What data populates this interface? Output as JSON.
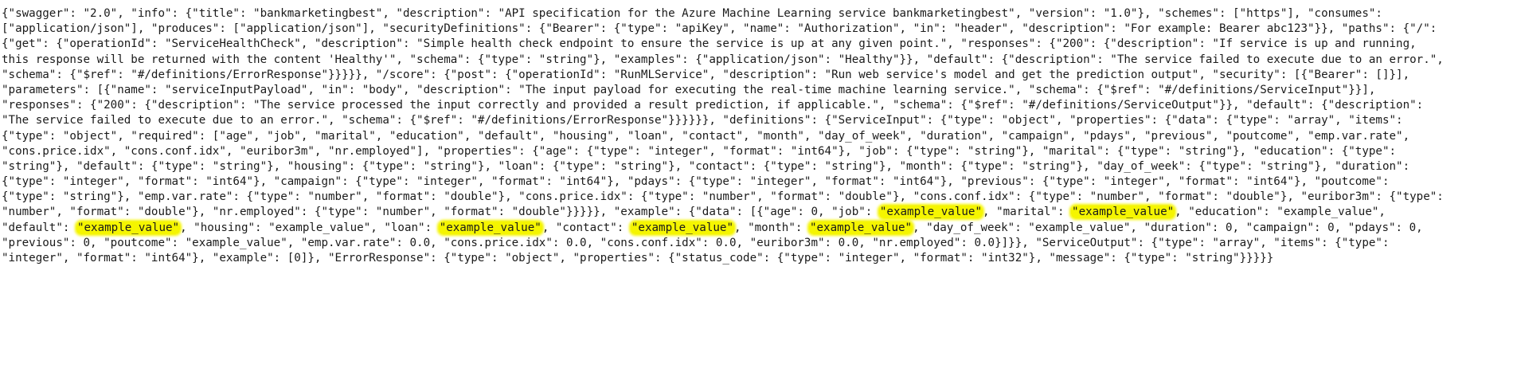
{
  "highlight_color": "#f5f500",
  "document": {
    "lines": [
      [
        {
          "text": "{\"swagger\": \"2.0\", \"info\": {\"title\": \"bankmarketingbest\", \"description\": \"API specification for the Azure Machine Learning service bankmarketingbest\", \"version\": \"1.0\"}, \"schemes\": [\"https\"], \"consumes\":",
          "highlight": false
        }
      ],
      [
        {
          "text": "[\"application/json\"], \"produces\": [\"application/json\"], \"securityDefinitions\": {\"Bearer\": {\"type\": \"apiKey\", \"name\": \"Authorization\", \"in\": \"header\", \"description\": \"For example: Bearer abc123\"}}, \"paths\": {\"/\":",
          "highlight": false
        }
      ],
      [
        {
          "text": "{\"get\": {\"operationId\": \"ServiceHealthCheck\", \"description\": \"Simple health check endpoint to ensure the service is up at any given point.\", \"responses\": {\"200\": {\"description\": \"If service is up and running,",
          "highlight": false
        }
      ],
      [
        {
          "text": "this response will be returned with the content 'Healthy'\", \"schema\": {\"type\": \"string\"}, \"examples\": {\"application/json\": \"Healthy\"}}, \"default\": {\"description\": \"The service failed to execute due to an error.\",",
          "highlight": false
        }
      ],
      [
        {
          "text": "\"schema\": {\"$ref\": \"#/definitions/ErrorResponse\"}}}}}, \"/score\": {\"post\": {\"operationId\": \"RunMLService\", \"description\": \"Run web service's model and get the prediction output\", \"security\": [{\"Bearer\": []}],",
          "highlight": false
        }
      ],
      [
        {
          "text": "\"parameters\": [{\"name\": \"serviceInputPayload\", \"in\": \"body\", \"description\": \"The input payload for executing the real-time machine learning service.\", \"schema\": {\"$ref\": \"#/definitions/ServiceInput\"}}],",
          "highlight": false
        }
      ],
      [
        {
          "text": "\"responses\": {\"200\": {\"description\": \"The service processed the input correctly and provided a result prediction, if applicable.\", \"schema\": {\"$ref\": \"#/definitions/ServiceOutput\"}}, \"default\": {\"description\":",
          "highlight": false
        }
      ],
      [
        {
          "text": "\"The service failed to execute due to an error.\", \"schema\": {\"$ref\": \"#/definitions/ErrorResponse\"}}}}}}, \"definitions\": {\"ServiceInput\": {\"type\": \"object\", \"properties\": {\"data\": {\"type\": \"array\", \"items\":",
          "highlight": false
        }
      ],
      [
        {
          "text": "{\"type\": \"object\", \"required\": [\"age\", \"job\", \"marital\", \"education\", \"default\", \"housing\", \"loan\", \"contact\", \"month\", \"day_of_week\", \"duration\", \"campaign\", \"pdays\", \"previous\", \"poutcome\", \"emp.var.rate\",",
          "highlight": false
        }
      ],
      [
        {
          "text": "\"cons.price.idx\", \"cons.conf.idx\", \"euribor3m\", \"nr.employed\"], \"properties\": {\"age\": {\"type\": \"integer\", \"format\": \"int64\"}, \"job\": {\"type\": \"string\"}, \"marital\": {\"type\": \"string\"}, \"education\": {\"type\":",
          "highlight": false
        }
      ],
      [
        {
          "text": "\"string\"}, \"default\": {\"type\": \"string\"}, \"housing\": {\"type\": \"string\"}, \"loan\": {\"type\": \"string\"}, \"contact\": {\"type\": \"string\"}, \"month\": {\"type\": \"string\"}, \"day_of_week\": {\"type\": \"string\"}, \"duration\":",
          "highlight": false
        }
      ],
      [
        {
          "text": "{\"type\": \"integer\", \"format\": \"int64\"}, \"campaign\": {\"type\": \"integer\", \"format\": \"int64\"}, \"pdays\": {\"type\": \"integer\", \"format\": \"int64\"}, \"previous\": {\"type\": \"integer\", \"format\": \"int64\"}, \"poutcome\":",
          "highlight": false
        }
      ],
      [
        {
          "text": "{\"type\": \"string\"}, \"emp.var.rate\": {\"type\": \"number\", \"format\": \"double\"}, \"cons.price.idx\": {\"type\": \"number\", \"format\": \"double\"}, \"cons.conf.idx\": {\"type\": \"number\", \"format\": \"double\"}, \"euribor3m\": {\"type\":",
          "highlight": false
        }
      ],
      [
        {
          "text": "\"number\", \"format\": \"double\"}, \"nr.employed\": {\"type\": \"number\", \"format\": \"double\"}}}}}, \"example\": {\"data\": [{\"age\": 0, \"job\": ",
          "highlight": false
        },
        {
          "text": "\"example_value\"",
          "highlight": true
        },
        {
          "text": ", \"marital\": ",
          "highlight": false
        },
        {
          "text": "\"example_value\"",
          "highlight": true
        },
        {
          "text": ", \"education\": \"example_value\",",
          "highlight": false
        }
      ],
      [
        {
          "text": "\"default\": ",
          "highlight": false
        },
        {
          "text": "\"example_value\"",
          "highlight": true
        },
        {
          "text": ", \"housing\": \"example_value\", \"loan\": ",
          "highlight": false
        },
        {
          "text": "\"example_value\"",
          "highlight": true
        },
        {
          "text": ", \"contact\": ",
          "highlight": false
        },
        {
          "text": "\"example_value\"",
          "highlight": true
        },
        {
          "text": ", \"month\": ",
          "highlight": false
        },
        {
          "text": "\"example_value\"",
          "highlight": true
        },
        {
          "text": ", \"day_of_week\": \"example_value\", \"duration\": 0, \"campaign\": 0, \"pdays\": 0,",
          "highlight": false
        }
      ],
      [
        {
          "text": "\"previous\": 0, \"poutcome\": \"example_value\", \"emp.var.rate\": 0.0, \"cons.price.idx\": 0.0, \"cons.conf.idx\": 0.0, \"euribor3m\": 0.0, \"nr.employed\": 0.0}]}}, \"ServiceOutput\": {\"type\": \"array\", \"items\": {\"type\":",
          "highlight": false
        }
      ],
      [
        {
          "text": "\"integer\", \"format\": \"int64\"}, \"example\": [0]}, \"ErrorResponse\": {\"type\": \"object\", \"properties\": {\"status_code\": {\"type\": \"integer\", \"format\": \"int32\"}, \"message\": {\"type\": \"string\"}}}}}",
          "highlight": false
        }
      ]
    ]
  }
}
